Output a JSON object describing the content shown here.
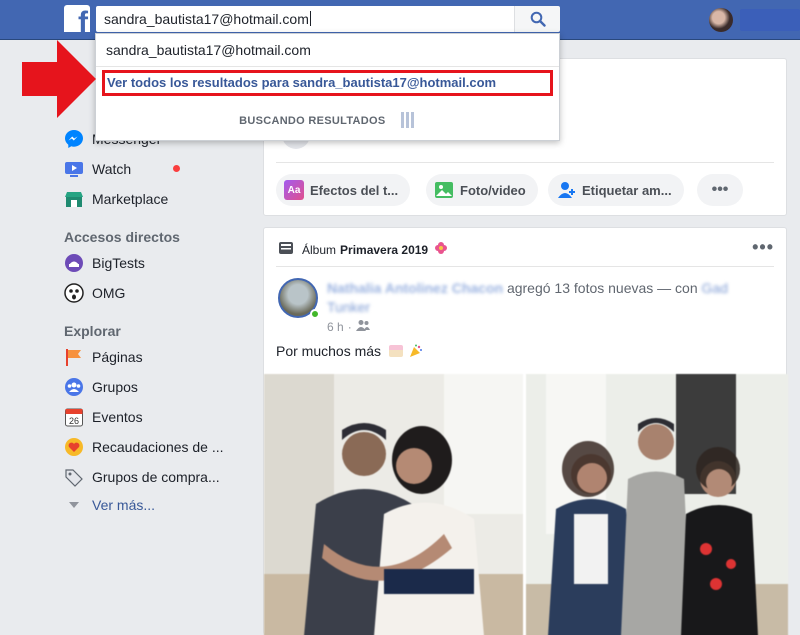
{
  "header": {
    "search_value": "sandra_bautista17@hotmail.com",
    "brand_color": "#4267b2"
  },
  "search_dropdown": {
    "suggestion": "sandra_bautista17@hotmail.com",
    "see_all": "Ver todos los resultados para sandra_bautista17@hotmail.com",
    "loading": "BUSCANDO RESULTADOS"
  },
  "sidebar": {
    "top_items": [
      {
        "label": "Messenger",
        "icon": "messenger-icon"
      },
      {
        "label": "Watch",
        "icon": "watch-icon"
      },
      {
        "label": "Marketplace",
        "icon": "marketplace-icon"
      }
    ],
    "shortcuts_title": "Accesos directos",
    "shortcuts": [
      {
        "label": "BigTests",
        "icon": "bigtests-icon"
      },
      {
        "label": "OMG",
        "icon": "omg-icon"
      }
    ],
    "explore_title": "Explorar",
    "explore": [
      {
        "label": "Páginas",
        "icon": "flag-icon"
      },
      {
        "label": "Grupos",
        "icon": "groups-icon"
      },
      {
        "label": "Eventos",
        "icon": "calendar-icon"
      },
      {
        "label": "Recaudaciones de ...",
        "icon": "fundraiser-icon"
      },
      {
        "label": "Grupos de compra...",
        "icon": "tag-icon"
      }
    ],
    "see_more": "Ver más..."
  },
  "composer": {
    "actions": [
      {
        "label": "Efectos del t...",
        "icon": "effects-icon"
      },
      {
        "label": "Foto/video",
        "icon": "photo-icon"
      },
      {
        "label": "Etiquetar am...",
        "icon": "tag-friends-icon"
      }
    ]
  },
  "post": {
    "album_prefix": "Álbum",
    "album_name": "Primavera 2019",
    "author": "Nathalia Antolinez Chacon",
    "action": " agregó 13 fotos nuevas — con ",
    "with": "Gad Tunker",
    "time": "6 h",
    "body": "Por muchos más"
  }
}
